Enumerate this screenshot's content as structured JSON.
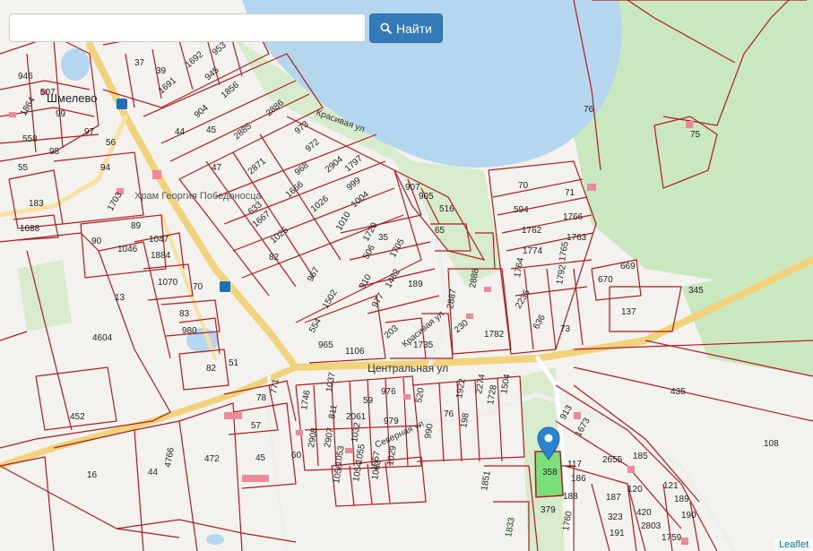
{
  "search": {
    "value": "",
    "placeholder": "",
    "button_label": "Найти",
    "button_icon": "search-icon"
  },
  "attribution": "Leaflet",
  "colors": {
    "water": "#b5d6ef",
    "green": "#c9e8c0",
    "boundary": "#b01c1c",
    "selected": "#7be07b",
    "road": "#f2d37d",
    "marker": "#2a84d3"
  },
  "place_labels": [
    {
      "id": "village",
      "text": "Шмелево"
    },
    {
      "id": "church",
      "text": "Храм Георгия Победоносца"
    }
  ],
  "streets": [
    {
      "id": "central",
      "text": "Центральная ул"
    },
    {
      "id": "krasivaya1",
      "text": "Красивая ул"
    },
    {
      "id": "krasivaya2",
      "text": "Красивая ул"
    },
    {
      "id": "severnaya",
      "text": "Северная ул"
    }
  ],
  "parcels": [
    "946",
    "507",
    "1864",
    "99",
    "558",
    "97",
    "98",
    "94",
    "183",
    "1688",
    "37",
    "39",
    "1692",
    "953",
    "1691",
    "945",
    "1856",
    "904",
    "44",
    "45",
    "2886",
    "47",
    "2885",
    "973",
    "972",
    "2871",
    "1797",
    "968",
    "2904",
    "999",
    "1666",
    "1026",
    "1004",
    "633",
    "1667",
    "1025",
    "1703",
    "89",
    "90",
    "1046",
    "1047",
    "1884",
    "1070",
    "83",
    "980",
    "82",
    "4604",
    "452",
    "16",
    "44",
    "4766",
    "472",
    "45",
    "60",
    "57",
    "78",
    "771",
    "1746",
    "1037",
    "811",
    "59",
    "976",
    "2061",
    "979",
    "1032",
    "2908",
    "2907",
    "1053",
    "1055",
    "1057",
    "1056",
    "1054",
    "1063",
    "1029",
    "520",
    "76",
    "990",
    "1922",
    "2274",
    "1728",
    "1504",
    "198",
    "1735",
    "203",
    "230",
    "1782",
    "2888",
    "2887",
    "65",
    "516",
    "905",
    "907",
    "70",
    "71",
    "594",
    "1766",
    "1762",
    "1763",
    "1774",
    "1765",
    "1764",
    "1792",
    "2235",
    "636",
    "73",
    "670",
    "669",
    "137",
    "76",
    "75",
    "345",
    "435",
    "108",
    "117",
    "2655",
    "185",
    "186",
    "188",
    "187",
    "120",
    "323",
    "420",
    "121",
    "189",
    "190",
    "191",
    "2803",
    "1759",
    "1760",
    "1851",
    "1833",
    "379",
    "358",
    "913",
    "1673",
    "1010",
    "1720",
    "506",
    "1705",
    "967",
    "910",
    "1482",
    "189",
    "1502",
    "977",
    "554",
    "965",
    "1106",
    "35",
    "13",
    "56",
    "55",
    "51",
    "70",
    "82"
  ],
  "selected_parcel": "1833"
}
